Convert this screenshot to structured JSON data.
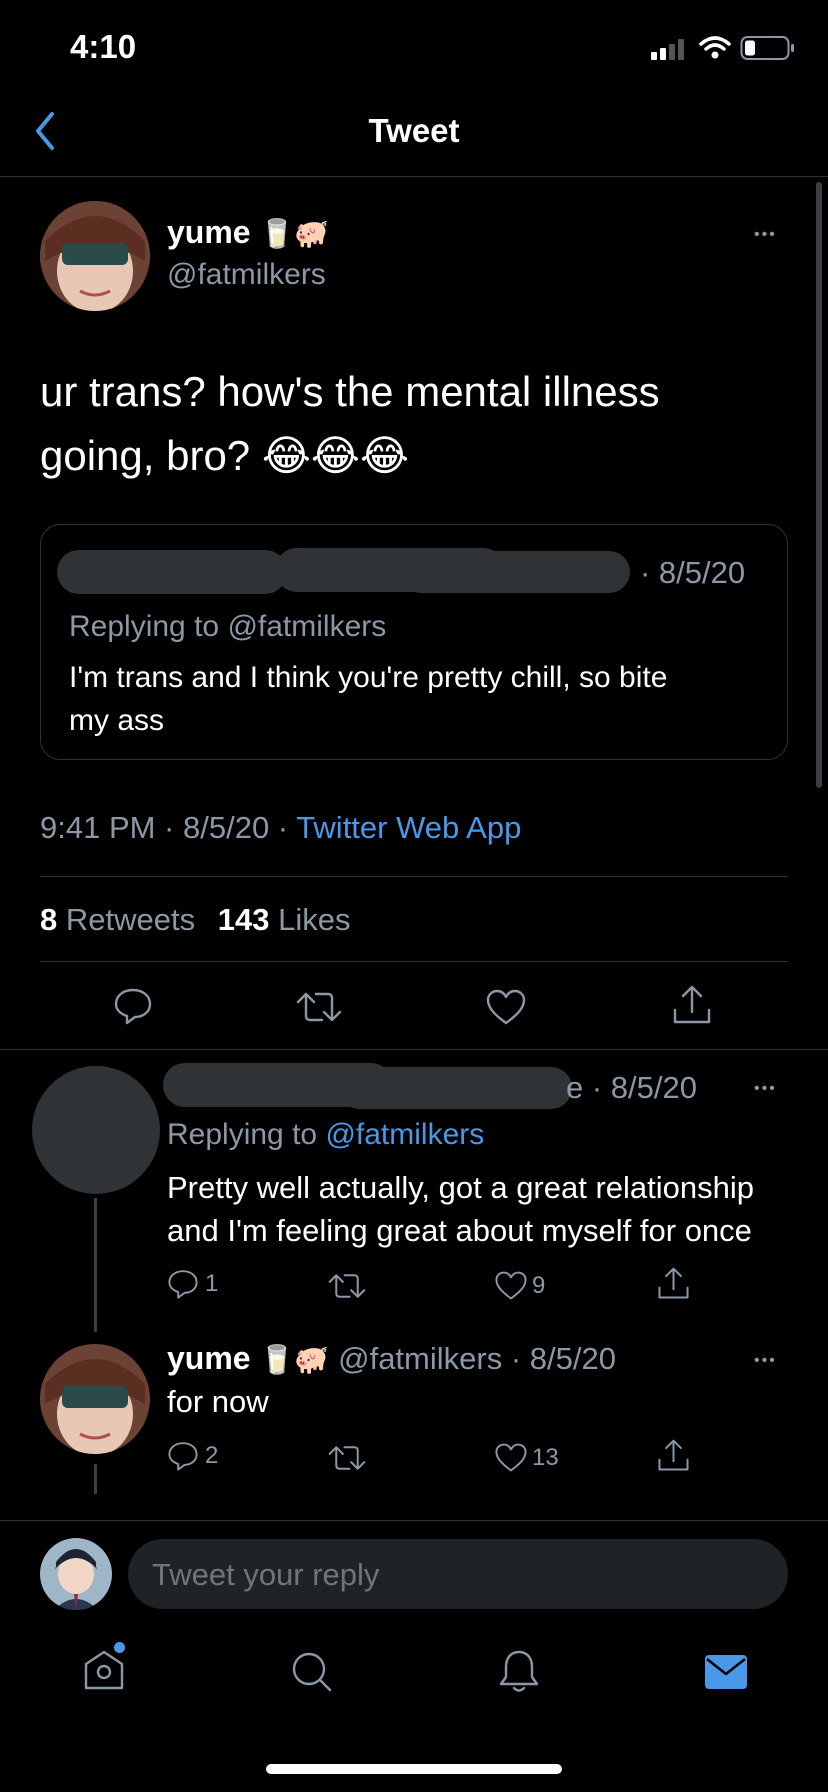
{
  "status_bar": {
    "time": "4:10"
  },
  "nav": {
    "title": "Tweet"
  },
  "main_tweet": {
    "display_name": "yume",
    "handle": "@fatmilkers",
    "emojis": "🥛🐖",
    "text_line1": "ur trans? how's the mental illness",
    "text_line2": "going, bro? 😂😂😂",
    "quote": {
      "date": "· 8/5/20",
      "replying_prefix": "Replying to",
      "replying_handle": "@fatmilkers",
      "text_line1": "I'm trans and I think you're pretty chill, so bite",
      "text_line2": "my ass"
    },
    "meta_time": "9:41 PM · 8/5/20 ·",
    "meta_source": "Twitter Web App",
    "retweets_count": "8",
    "retweets_label": "Retweets",
    "likes_count": "143",
    "likes_label": "Likes"
  },
  "reply1": {
    "name_tail": "e",
    "date": "· 8/5/20",
    "replying_prefix": "Replying to",
    "replying_handle": "@fatmilkers",
    "text_line1": "Pretty well actually, got a great relationship",
    "text_line2": "and I'm feeling great about myself for once",
    "reply_count": "1",
    "like_count": "9"
  },
  "reply2": {
    "display_name": "yume",
    "emojis": "🥛🐖",
    "handle_date": "@fatmilkers · 8/5/20",
    "text": "for now",
    "reply_count": "2",
    "like_count": "13"
  },
  "composer": {
    "placeholder": "Tweet your reply"
  },
  "more_label": "•••"
}
